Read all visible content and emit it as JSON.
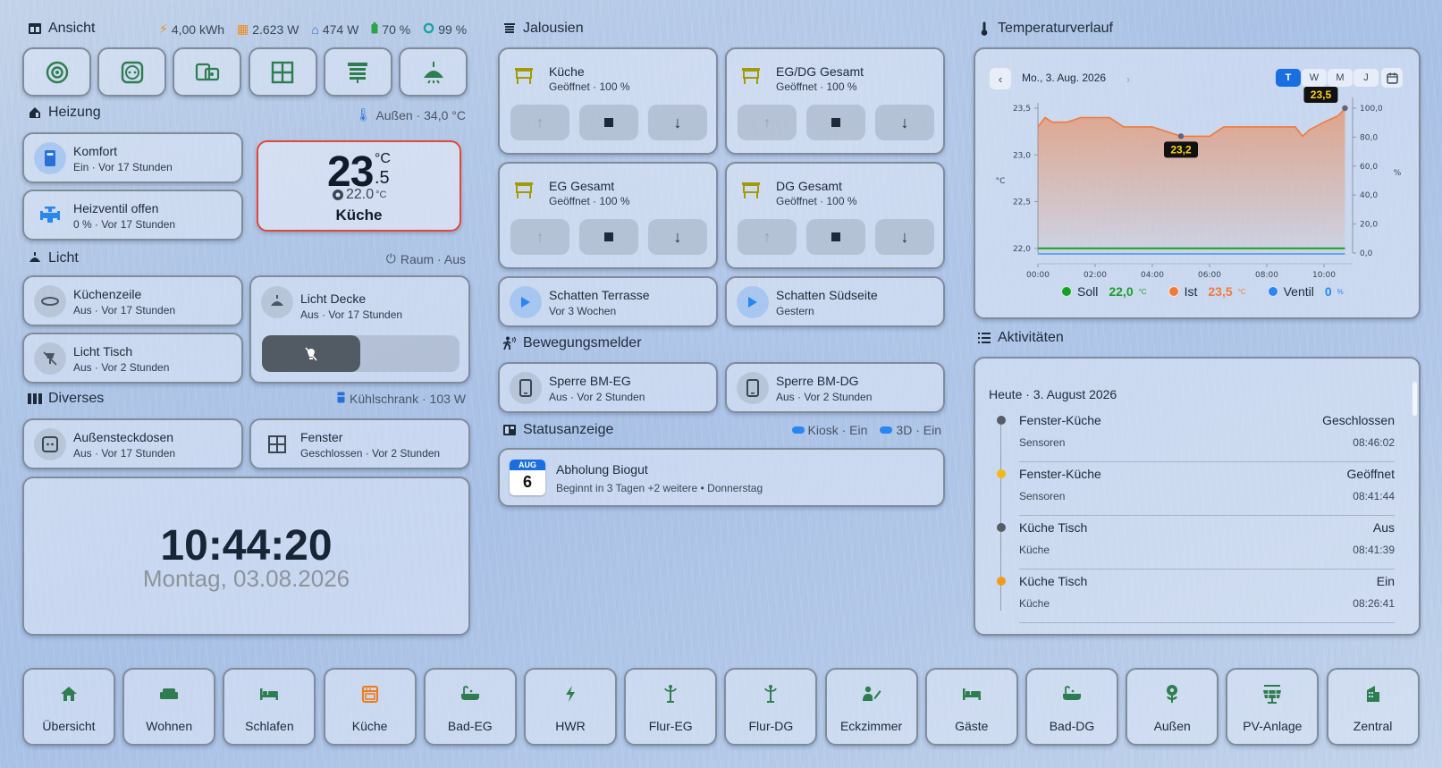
{
  "header": {
    "title": "Ansicht",
    "energy": "4,00 kWh",
    "power": "2.623 W",
    "house": "474 W",
    "battery": "70 %",
    "autarky": "99 %"
  },
  "view_buttons": [
    "eye-icon",
    "power-socket-icon",
    "devices-icon",
    "window-icon",
    "blinds-icon",
    "ceiling-light-icon"
  ],
  "heizung": {
    "title": "Heizung",
    "outdoor": "Außen · 34,0 °C",
    "komfort": {
      "name": "Komfort",
      "status": "Ein · Vor 17 Stunden"
    },
    "valve": {
      "name": "Heizventil offen",
      "status": "0 % · Vor 17 Stunden"
    },
    "thermostat": {
      "temp_int": "23",
      "temp_dec": ".5",
      "unit": "°C",
      "target": "22.0",
      "target_unit": "°C",
      "room": "Küche"
    }
  },
  "licht": {
    "title": "Licht",
    "meta": "Raum · Aus",
    "kuechenzeile": {
      "name": "Küchenzeile",
      "status": "Aus · Vor 17 Stunden"
    },
    "tisch": {
      "name": "Licht Tisch",
      "status": "Aus · Vor 2 Stunden"
    },
    "decke": {
      "name": "Licht Decke",
      "status": "Aus · Vor 17 Stunden"
    }
  },
  "diverses": {
    "title": "Diverses",
    "meta": "Kühlschrank · 103 W",
    "steckdosen": {
      "name": "Außensteckdosen",
      "status": "Aus · Vor 17 Stunden"
    },
    "fenster": {
      "name": "Fenster",
      "status": "Geschlossen · Vor 2 Stunden"
    }
  },
  "clock": {
    "time": "10:44:20",
    "date": "Montag, 03.08.2026"
  },
  "jalousien": {
    "title": "Jalousien",
    "items": [
      {
        "name": "Küche",
        "status": "Geöffnet · 100 %"
      },
      {
        "name": "EG/DG Gesamt",
        "status": "Geöffnet · 100 %"
      },
      {
        "name": "EG Gesamt",
        "status": "Geöffnet · 100 %"
      },
      {
        "name": "DG Gesamt",
        "status": "Geöffnet · 100 %"
      }
    ],
    "scenes": [
      {
        "name": "Schatten Terrasse",
        "status": "Vor 3 Wochen"
      },
      {
        "name": "Schatten Südseite",
        "status": "Gestern"
      }
    ]
  },
  "bewegung": {
    "title": "Bewegungsmelder",
    "items": [
      {
        "name": "Sperre BM-EG",
        "status": "Aus · Vor 2 Stunden"
      },
      {
        "name": "Sperre BM-DG",
        "status": "Aus · Vor 2 Stunden"
      }
    ]
  },
  "status": {
    "title": "Statusanzeige",
    "kiosk": "Kiosk · Ein",
    "threed": "3D · Ein",
    "event": {
      "month": "AUG",
      "day": "6",
      "title": "Abholung Biogut",
      "detail": "Beginnt in 3 Tagen +2 weitere • Donnerstag"
    }
  },
  "temp": {
    "title": "Temperaturverlauf",
    "date": "Mo., 3. Aug. 2026",
    "ranges": [
      "T",
      "W",
      "M",
      "J"
    ],
    "active_range": "T",
    "legend": [
      {
        "name": "Soll",
        "value": "22,0",
        "unit": "°C",
        "color": "#1a9e2a"
      },
      {
        "name": "Ist",
        "value": "23,5",
        "unit": "°C",
        "color": "#f07a3a"
      },
      {
        "name": "Ventil",
        "value": "0",
        "unit": "%",
        "color": "#2a86f0"
      }
    ]
  },
  "chart_data": {
    "type": "line",
    "x": [
      "00:00",
      "00:15",
      "00:30",
      "01:00",
      "01:30",
      "02:00",
      "02:30",
      "03:00",
      "03:30",
      "04:00",
      "04:30",
      "05:00",
      "05:30",
      "06:00",
      "06:30",
      "07:00",
      "07:30",
      "08:00",
      "08:30",
      "09:00",
      "09:15",
      "09:30",
      "10:00",
      "10:30",
      "10:44"
    ],
    "xticks": [
      "00:00",
      "02:00",
      "04:00",
      "06:00",
      "08:00",
      "10:00"
    ],
    "series": [
      {
        "name": "Ist",
        "axis": "left",
        "values": [
          23.3,
          23.4,
          23.35,
          23.35,
          23.4,
          23.4,
          23.4,
          23.3,
          23.3,
          23.3,
          23.25,
          23.2,
          23.2,
          23.2,
          23.3,
          23.3,
          23.3,
          23.3,
          23.3,
          23.3,
          23.2,
          23.27,
          23.35,
          23.42,
          23.5
        ]
      },
      {
        "name": "Soll",
        "axis": "left",
        "values": [
          22.0,
          22.0,
          22.0,
          22.0,
          22.0,
          22.0,
          22.0,
          22.0,
          22.0,
          22.0,
          22.0,
          22.0,
          22.0,
          22.0,
          22.0,
          22.0,
          22.0,
          22.0,
          22.0,
          22.0,
          22.0,
          22.0,
          22.0,
          22.0,
          22.0
        ]
      },
      {
        "name": "Ventil",
        "axis": "right",
        "values": [
          0,
          0,
          0,
          0,
          0,
          0,
          0,
          0,
          0,
          0,
          0,
          0,
          0,
          0,
          0,
          0,
          0,
          0,
          0,
          0,
          0,
          0,
          0,
          0,
          0
        ]
      }
    ],
    "ylim_left": [
      21.95,
      23.5
    ],
    "yticks_left": [
      "23,5",
      "23,0",
      "22,5",
      "22,0"
    ],
    "ylabel_left": "°C",
    "ylim_right": [
      0,
      100
    ],
    "yticks_right": [
      "100,0",
      "80,0",
      "60,0",
      "40,0",
      "20,0",
      "0,0"
    ],
    "ylabel_right": "%",
    "annotations": [
      {
        "x": "05:00",
        "label": "23,2"
      },
      {
        "x": "10:44",
        "label": "23,5"
      }
    ]
  },
  "activities": {
    "title": "Aktivitäten",
    "day": "Heute · 3. August 2026",
    "items": [
      {
        "name": "Fenster-Küche",
        "area": "Sensoren",
        "state": "Geschlossen",
        "time": "08:46:02",
        "color": "#555c66"
      },
      {
        "name": "Fenster-Küche",
        "area": "Sensoren",
        "state": "Geöffnet",
        "time": "08:41:44",
        "color": "#f3b817"
      },
      {
        "name": "Küche Tisch",
        "area": "Küche",
        "state": "Aus",
        "time": "08:41:39",
        "color": "#555c66"
      },
      {
        "name": "Küche Tisch",
        "area": "Küche",
        "state": "Ein",
        "time": "08:26:41",
        "color": "#f39a17"
      }
    ]
  },
  "nav": [
    {
      "label": "Übersicht",
      "icon": "home-icon",
      "active": false
    },
    {
      "label": "Wohnen",
      "icon": "sofa-icon",
      "active": false
    },
    {
      "label": "Schlafen",
      "icon": "bed-icon",
      "active": false
    },
    {
      "label": "Küche",
      "icon": "stove-icon",
      "active": true
    },
    {
      "label": "Bad-EG",
      "icon": "bathtub-icon",
      "active": false
    },
    {
      "label": "HWR",
      "icon": "lightning-icon",
      "active": false
    },
    {
      "label": "Flur-EG",
      "icon": "coat-rack-icon",
      "active": false
    },
    {
      "label": "Flur-DG",
      "icon": "coat-rack-icon",
      "active": false
    },
    {
      "label": "Eckzimmer",
      "icon": "desk-person-icon",
      "active": false
    },
    {
      "label": "Gäste",
      "icon": "bed-icon",
      "active": false
    },
    {
      "label": "Bad-DG",
      "icon": "bathtub-icon",
      "active": false
    },
    {
      "label": "Außen",
      "icon": "flower-icon",
      "active": false
    },
    {
      "label": "PV-Anlage",
      "icon": "solar-panel-icon",
      "active": false
    },
    {
      "label": "Zentral",
      "icon": "building-icon",
      "active": false
    }
  ],
  "colors": {
    "green": "#2e7d4f",
    "olive": "#a39b05",
    "blue": "#2a86f0",
    "orange": "#f07a3a",
    "accent": "#1a6fe0"
  }
}
